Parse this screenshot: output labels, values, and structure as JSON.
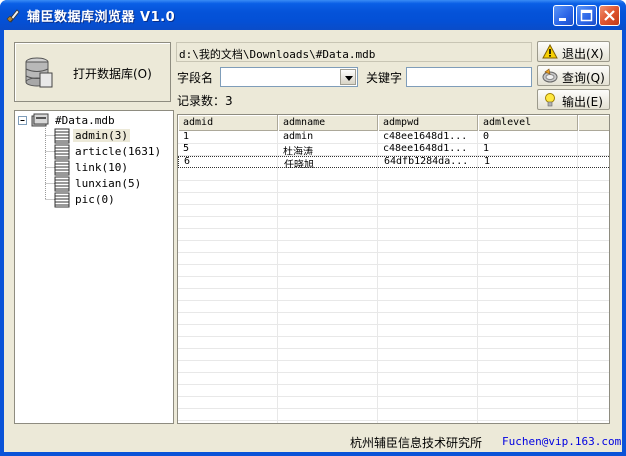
{
  "window": {
    "title": "辅臣数据库浏览器 V1.0"
  },
  "open_db": {
    "label": "打开数据库(O)"
  },
  "path": {
    "value": "d:\\我的文档\\Downloads\\#Data.mdb"
  },
  "filter": {
    "field_label": "字段名",
    "field_value": "",
    "keyword_label": "关键字",
    "keyword_value": ""
  },
  "record_count": {
    "text": "记录数：3"
  },
  "buttons": {
    "exit": "退出(X)",
    "query": "查询(Q)",
    "export": "输出(E)"
  },
  "tree": {
    "root": "#Data.mdb",
    "tables": [
      {
        "label": "admin(3)"
      },
      {
        "label": "article(1631)"
      },
      {
        "label": "link(10)"
      },
      {
        "label": "lunxian(5)"
      },
      {
        "label": "pic(0)"
      }
    ]
  },
  "grid": {
    "columns": [
      "admid",
      "admname",
      "admpwd",
      "admlevel"
    ],
    "rows": [
      [
        "1",
        "admin",
        "c48ee1648d1...",
        "0"
      ],
      [
        "5",
        "杜海涛",
        "c48ee1648d1...",
        "1"
      ],
      [
        "6",
        "任晓旭",
        "64dfb1284da...",
        "1"
      ]
    ]
  },
  "status": {
    "company": "杭州辅臣信息技术研究所",
    "email": "Fuchen@vip.163.com"
  }
}
